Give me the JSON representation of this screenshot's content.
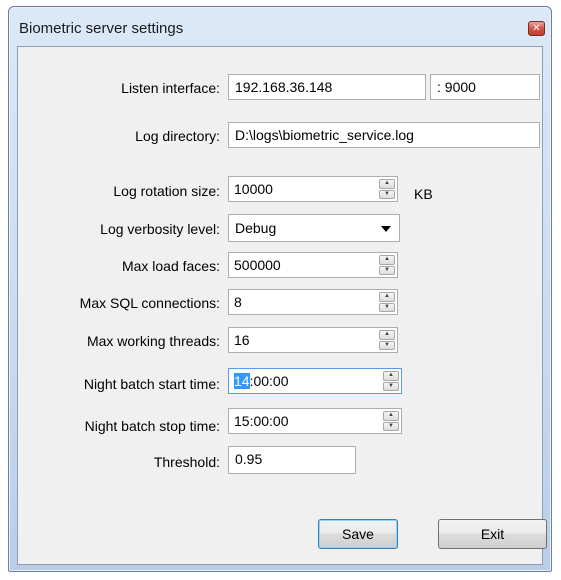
{
  "window": {
    "title": "Biometric server settings"
  },
  "fields": {
    "listen_interface": {
      "label": "Listen interface:",
      "ip": "192.168.36.148",
      "port": ": 9000"
    },
    "log_directory": {
      "label": "Log directory:",
      "value": "D:\\logs\\biometric_service.log"
    },
    "log_rotation_size": {
      "label": "Log rotation size:",
      "value": "10000",
      "unit": "KB"
    },
    "log_verbosity_level": {
      "label": "Log verbosity level:",
      "value": "Debug"
    },
    "max_load_faces": {
      "label": "Max load faces:",
      "value": "500000"
    },
    "max_sql_connections": {
      "label": "Max SQL connections:",
      "value": "8"
    },
    "max_working_threads": {
      "label": "Max working threads:",
      "value": "16"
    },
    "night_batch_start_time": {
      "label": "Night batch start time:",
      "value_selected": "14",
      "value_rest": ":00:00"
    },
    "night_batch_stop_time": {
      "label": "Night batch stop time:",
      "value": "15:00:00"
    },
    "threshold": {
      "label": "Threshold:",
      "value": "0.95"
    }
  },
  "buttons": {
    "save": "Save",
    "exit": "Exit"
  },
  "icons": {
    "close": "close-icon",
    "spin_up": "spin-up-icon",
    "spin_down": "spin-down-icon",
    "dropdown": "chevron-down-icon"
  },
  "colors": {
    "selection": "#3399ff",
    "focus_border": "#569de5",
    "close_button": "#c13b2c"
  }
}
